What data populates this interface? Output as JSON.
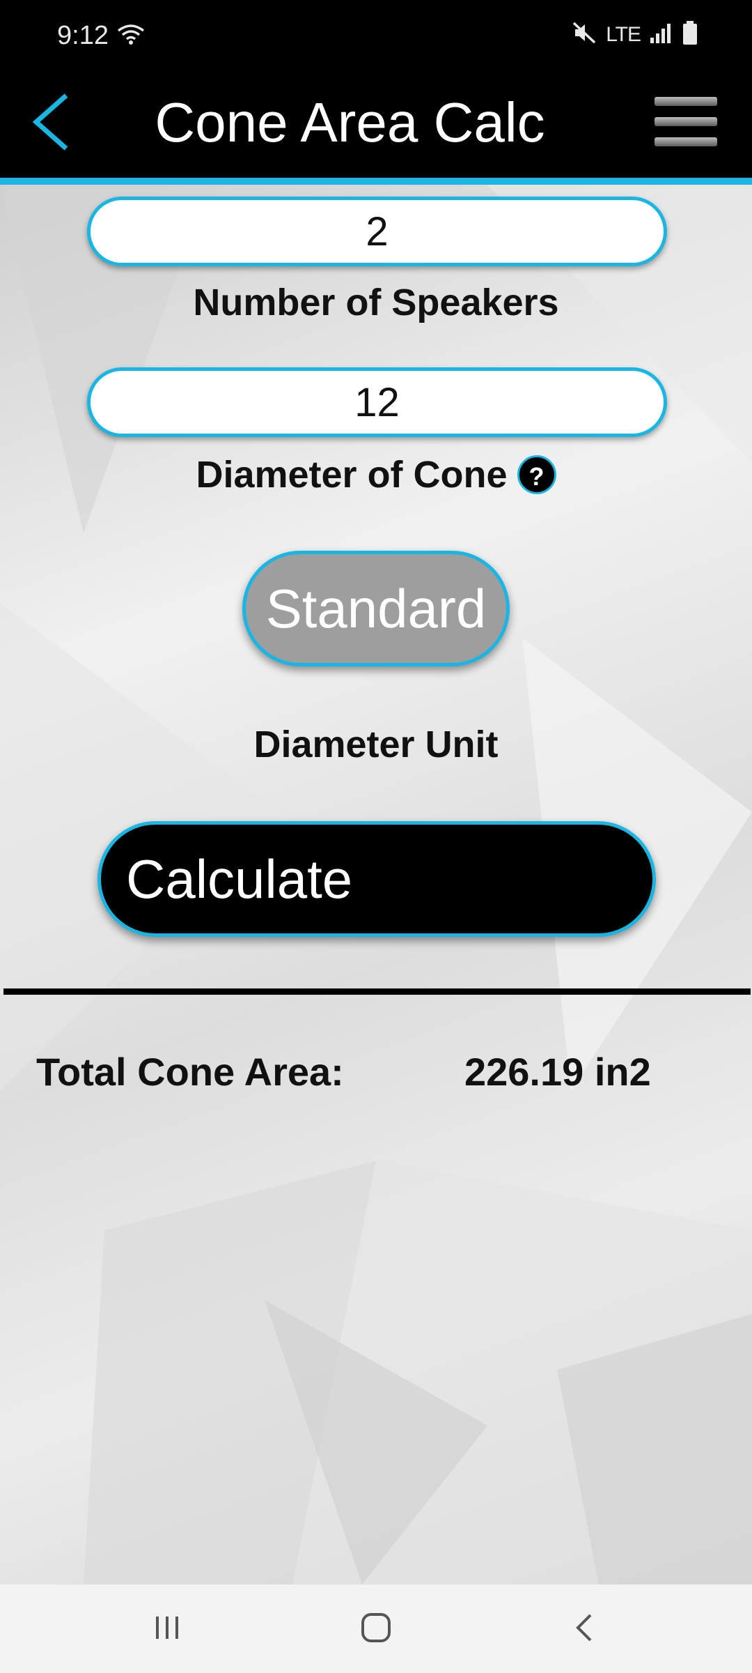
{
  "status_bar": {
    "time": "9:12",
    "network": "LTE",
    "icons": [
      "wifi-icon",
      "mute-icon",
      "signal-icon",
      "battery-icon"
    ]
  },
  "app_bar": {
    "title": "Cone Area Calc",
    "back_icon": "chevron-left-icon",
    "menu_icon": "hamburger-menu-icon",
    "accent_color": "#1ab6e3"
  },
  "form": {
    "speakers": {
      "value": "2",
      "label": "Number of Speakers"
    },
    "diameter": {
      "value": "12",
      "label": "Diameter of Cone",
      "help": "?"
    },
    "unit": {
      "button_label": "Standard",
      "label": "Diameter Unit"
    },
    "calculate_label": "Calculate"
  },
  "result": {
    "label": "Total Cone Area:",
    "value": "226.19 in2"
  },
  "nav_bar": {
    "icons": [
      "recent-apps-icon",
      "home-icon",
      "back-icon"
    ]
  }
}
